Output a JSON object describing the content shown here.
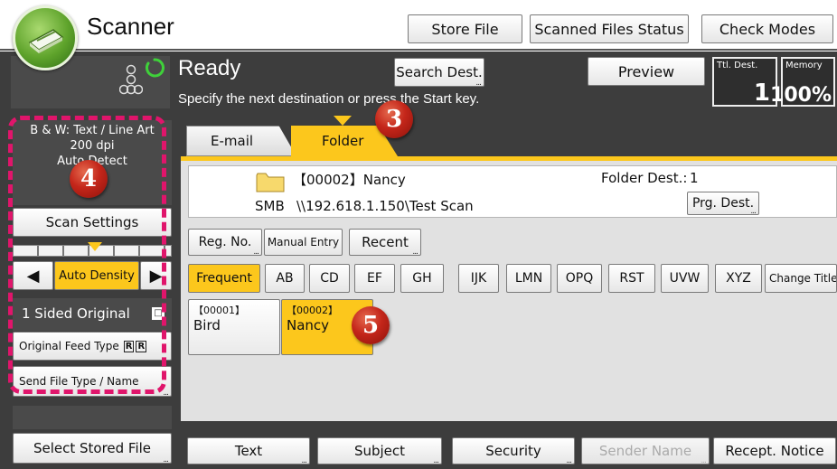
{
  "header": {
    "app_title": "Scanner",
    "store_file": "Store File",
    "scanned_files_status": "Scanned Files Status",
    "check_modes": "Check Modes"
  },
  "status": {
    "state": "Ready",
    "message": "Specify the next destination or press the Start key.",
    "search_dest": "Search Dest.",
    "preview": "Preview",
    "ttl_dest_label": "Ttl. Dest.",
    "ttl_dest_value": "1",
    "memory_label": "Memory",
    "memory_value": "100%"
  },
  "left_panel": {
    "scan_summary_line1": "B & W: Text / Line Art",
    "scan_summary_line2": "200 dpi",
    "scan_summary_line3": "Auto Detect",
    "scan_settings": "Scan Settings",
    "auto_density": "Auto Density",
    "sided_original": "1 Sided Original",
    "original_feed_type": "Original Feed Type",
    "send_file_type": "Send File Type / Name",
    "select_stored_file": "Select Stored File"
  },
  "tabs": [
    {
      "label": "E-mail",
      "selected": false
    },
    {
      "label": "Folder",
      "selected": true
    }
  ],
  "destination": {
    "reg_name": "【00002】Nancy",
    "protocol": "SMB",
    "path": "\\\\192.618.1.150\\Test Scan",
    "folder_dest_label": "Folder Dest.:",
    "folder_dest_count": "1",
    "prg_dest": "Prg. Dest."
  },
  "entry_buttons": {
    "reg_no": "Reg. No.",
    "manual_entry": "Manual Entry",
    "recent": "Recent"
  },
  "index_tabs": [
    {
      "label": "Frequent",
      "selected": true
    },
    {
      "label": "AB",
      "selected": false
    },
    {
      "label": "CD",
      "selected": false
    },
    {
      "label": "EF",
      "selected": false
    },
    {
      "label": "GH",
      "selected": false
    },
    {
      "label": "IJK",
      "selected": false
    },
    {
      "label": "LMN",
      "selected": false
    },
    {
      "label": "OPQ",
      "selected": false
    },
    {
      "label": "RST",
      "selected": false
    },
    {
      "label": "UVW",
      "selected": false
    },
    {
      "label": "XYZ",
      "selected": false
    }
  ],
  "change_title": "Change Title",
  "address_entries": [
    {
      "number": "【00001】",
      "name": "Bird",
      "selected": false
    },
    {
      "number": "【00002】",
      "name": "Nancy",
      "selected": true
    }
  ],
  "bottom_toolbar": {
    "text": "Text",
    "subject": "Subject",
    "security": "Security",
    "sender_name": "Sender Name",
    "recept_notice": "Recept. Notice"
  },
  "callouts": [
    "3",
    "4",
    "5"
  ],
  "colors": {
    "highlight_yellow": "#fcc71c",
    "frame_dark": "#3b3b3b",
    "callout_red": "#c4261a",
    "dashed_pink": "#e0156b"
  }
}
